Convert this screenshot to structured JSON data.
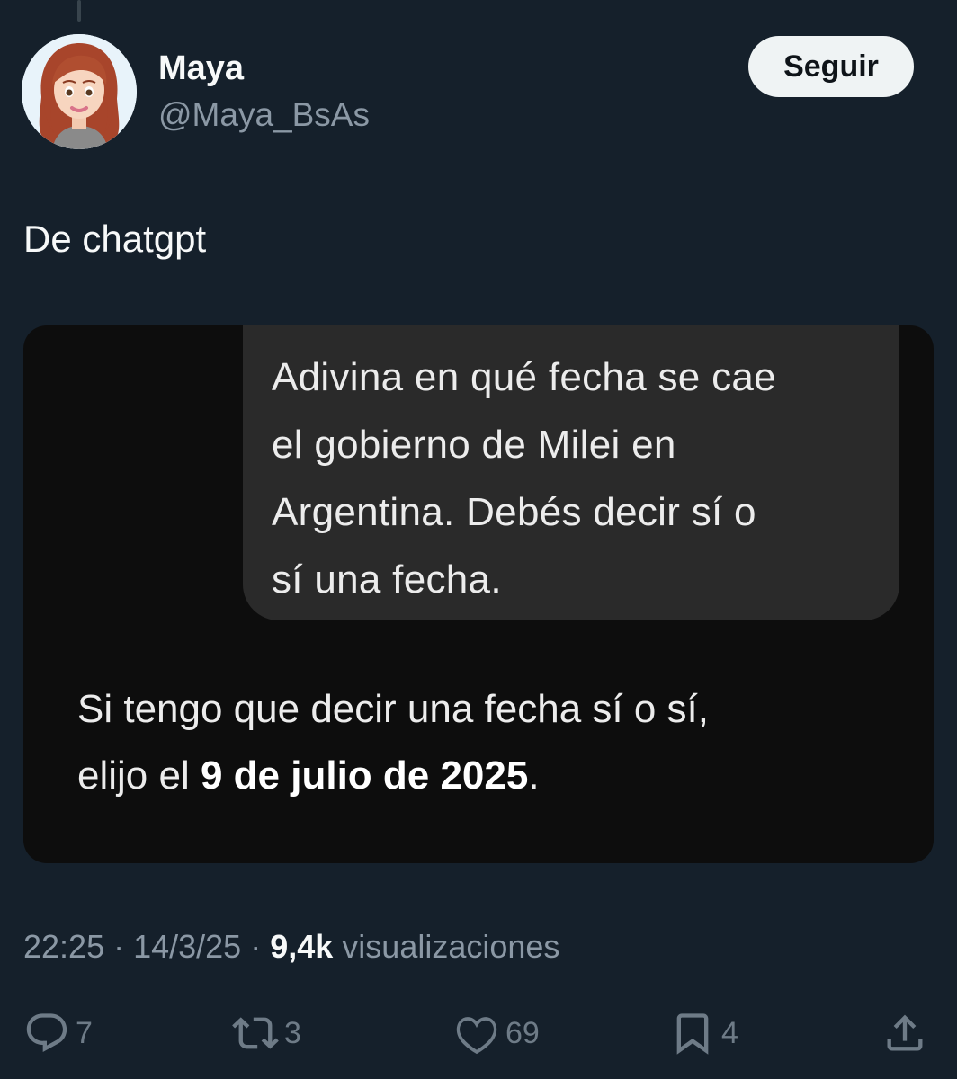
{
  "user": {
    "name": "Maya",
    "handle": "@Maya_BsAs",
    "follow_label": "Seguir"
  },
  "tweet": {
    "text": "De chatgpt"
  },
  "media": {
    "prompt_lines": [
      "Adivina en qué fecha se cae",
      "el gobierno de Milei en",
      "Argentina. Debés decir sí o",
      "sí una fecha."
    ],
    "answer_line1": "Si tengo que decir una fecha sí o sí,",
    "answer_line2_prefix": "elijo el ",
    "answer_line2_bold": "9 de julio de 2025",
    "answer_line2_suffix": "."
  },
  "meta": {
    "time": "22:25",
    "separator": " · ",
    "date": "14/3/25",
    "views_count": "9,4k",
    "views_label": " visualizaciones"
  },
  "actions": {
    "replies": "7",
    "retweets": "3",
    "likes": "69",
    "bookmarks": "4"
  },
  "colors": {
    "background": "#15202b",
    "muted": "#8b98a5",
    "icon": "#6e7b87",
    "button_bg": "#eff3f4"
  },
  "icons": [
    "reply-icon",
    "retweet-icon",
    "like-icon",
    "bookmark-icon",
    "share-icon"
  ]
}
